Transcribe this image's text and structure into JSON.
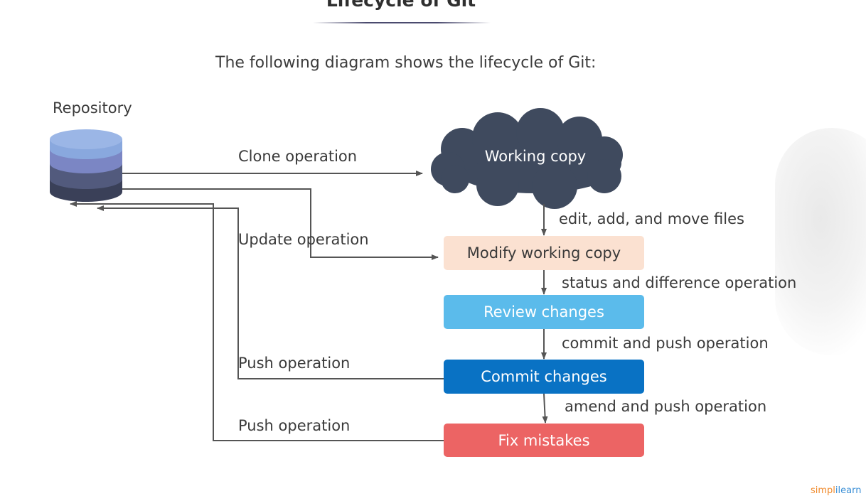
{
  "title": "Lifecycle of Git",
  "intro": "The following diagram shows the lifecycle of Git:",
  "repository": {
    "label": "Repository"
  },
  "cloud": {
    "label": "Working copy"
  },
  "steps": [
    {
      "label": "Modify working copy",
      "fill": "#fbe1d1",
      "text_color": "#3a3a3a"
    },
    {
      "label": "Review changes",
      "fill": "#5bbbeb",
      "text_color": "#ffffff"
    },
    {
      "label": "Commit changes",
      "fill": "#0972c4",
      "text_color": "#ffffff"
    },
    {
      "label": "Fix mistakes",
      "fill": "#ec6464",
      "text_color": "#ffffff"
    }
  ],
  "operations": {
    "clone": "Clone operation",
    "update": "Update operation",
    "push_commit": "Push operation",
    "push_fix": "Push operation"
  },
  "transitions": [
    "edit, add, and move files",
    "status and difference operation",
    "commit and push operation",
    "amend and push operation"
  ],
  "colors": {
    "cloud": "#3f4a5e",
    "db_top": "#89a8de",
    "db_band1": "#7b86c4",
    "db_band2": "#525a7d",
    "db_band3": "#3a4058",
    "arrows": "#555555"
  },
  "branding": {
    "left": "simpl",
    "right": "ilearn"
  }
}
